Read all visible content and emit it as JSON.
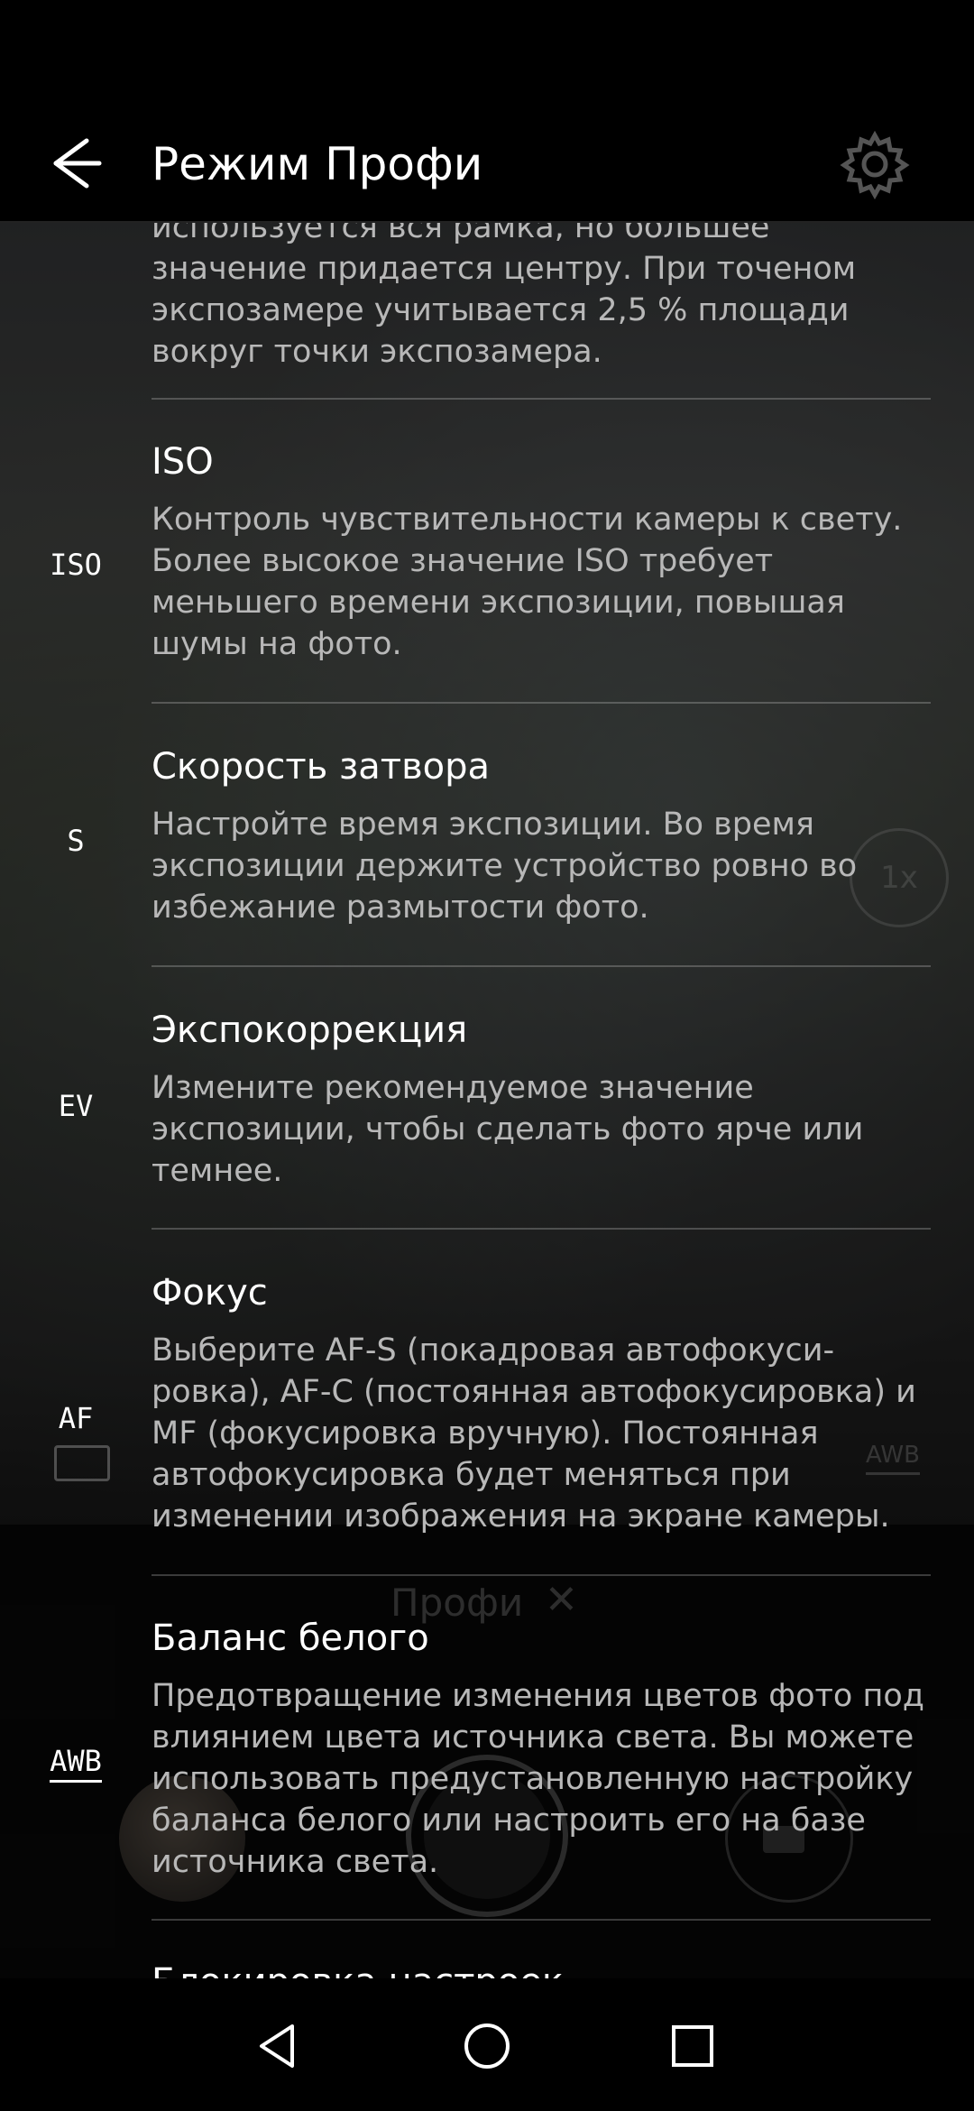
{
  "app_bar": {
    "title": "Режим Профи"
  },
  "list": {
    "items": [
      {
        "side_label": "",
        "title": "",
        "description": "используется вся рамка, но большее значение придается центру. При точеном экспозамере учитывается 2,5 % площади вокруг точки экспозамера."
      },
      {
        "side_label": "ISO",
        "title": "ISO",
        "description": "Контроль чувствительности камеры к свету. Более высокое значение ISO требует меньшего времени экспозиции, повышая шумы на фото."
      },
      {
        "side_label": "S",
        "title": "Скорость затвора",
        "description": "Настройте время экспозиции. Во время экспозиции держите устройство ровно во избежание размытости фото."
      },
      {
        "side_label": "EV",
        "title": "Экспокоррекция",
        "description": "Измените рекомендуемое значение экспозиции, чтобы сделать фото ярче или темнее."
      },
      {
        "side_label": "AF",
        "title": "Фокус",
        "description": "Выберите AF-S (покадровая автофокуси-ровка), AF-C (постоянная автофокусировка) и MF (фокусировка вручную). Постоянная автофокусировка будет меняться при изменении изображения на экране камеры."
      },
      {
        "side_label": "AWB",
        "title": "Баланс белого",
        "description": "Предотвращение изменения цветов фото под влиянием цвета источника света. Вы можете использовать предустановленную настройку баланса белого или настроить его на базе источника света."
      },
      {
        "side_label": "",
        "title": "Блокировка настроек",
        "description": ""
      }
    ]
  },
  "camera": {
    "zoom": "1x",
    "white_balance": "AWB",
    "mode_label": "Профи"
  },
  "colors": {
    "background": "#000000",
    "text_primary": "#ffffff",
    "text_secondary": "#b8b8b8",
    "divider": "#4a4a4a"
  },
  "icons": {
    "back": "arrow-left-icon",
    "settings": "gear-icon",
    "nav_back": "triangle-back-icon",
    "nav_home": "circle-home-icon",
    "nav_recents": "square-recents-icon"
  }
}
